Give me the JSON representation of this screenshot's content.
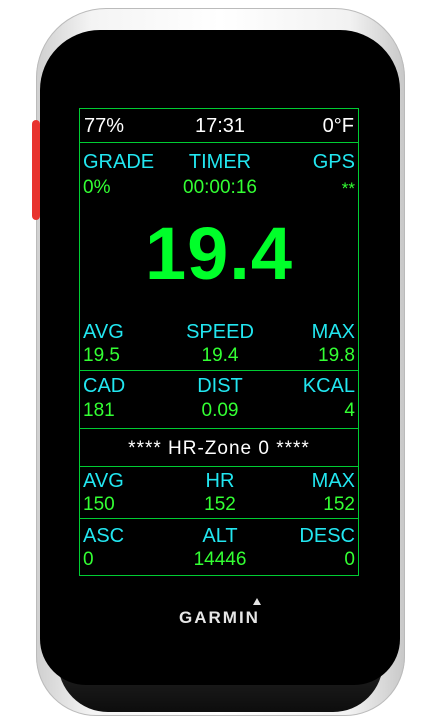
{
  "status": {
    "battery": "77%",
    "time": "17:31",
    "temperature": "0°F"
  },
  "top": {
    "grade_label": "GRADE",
    "grade_value": "0%",
    "timer_label": "TIMER",
    "timer_value": "00:00:16",
    "gps_label": "GPS",
    "gps_value": "**"
  },
  "main_speed": "19.4",
  "speed_row": {
    "avg_label": "AVG",
    "avg_value": "19.5",
    "speed_label": "SPEED",
    "speed_value": "19.4",
    "max_label": "MAX",
    "max_value": "19.8"
  },
  "cad_row": {
    "cad_label": "CAD",
    "cad_value": "181",
    "dist_label": "DIST",
    "dist_value": "0.09",
    "kcal_label": "KCAL",
    "kcal_value": "4"
  },
  "hr_zone": "**** HR-Zone 0 ****",
  "hr_row": {
    "avg_label": "AVG",
    "avg_value": "150",
    "hr_label": "HR",
    "hr_value": "152",
    "max_label": "MAX",
    "max_value": "152"
  },
  "alt_row": {
    "asc_label": "ASC",
    "asc_value": "0",
    "alt_label": "ALT",
    "alt_value": "14446",
    "desc_label": "DESC",
    "desc_value": "0"
  },
  "brand": "GARMIN",
  "colors": {
    "label": "#22e6f0",
    "value": "#33ff33",
    "big": "#00ff2a",
    "border": "#00cc33",
    "side_button": "#e8332e"
  }
}
